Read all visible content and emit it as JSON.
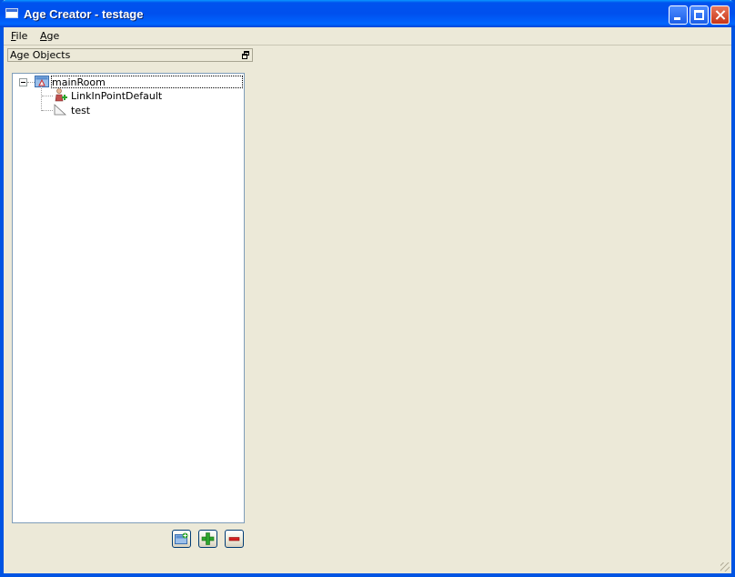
{
  "window": {
    "title": "Age Creator - testage"
  },
  "menu": {
    "file": {
      "accel": "F",
      "rest": "ile"
    },
    "age": {
      "accel": "A",
      "rest": "ge"
    }
  },
  "dock": {
    "title": "Age Objects"
  },
  "tree": {
    "root": {
      "label": "mainRoom",
      "icon": "room-icon",
      "expanded": true
    },
    "children": [
      {
        "label": "LinkInPointDefault",
        "icon": "link-in-point-icon"
      },
      {
        "label": "test",
        "icon": "object-icon"
      }
    ]
  },
  "toolbar": {
    "buttons": [
      {
        "icon": "add-room-icon"
      },
      {
        "icon": "add-icon"
      },
      {
        "icon": "remove-icon"
      }
    ]
  },
  "colors": {
    "titlebar": "#0054e3",
    "background": "#ece9d8",
    "add": "#2da42d",
    "remove": "#d42020"
  }
}
